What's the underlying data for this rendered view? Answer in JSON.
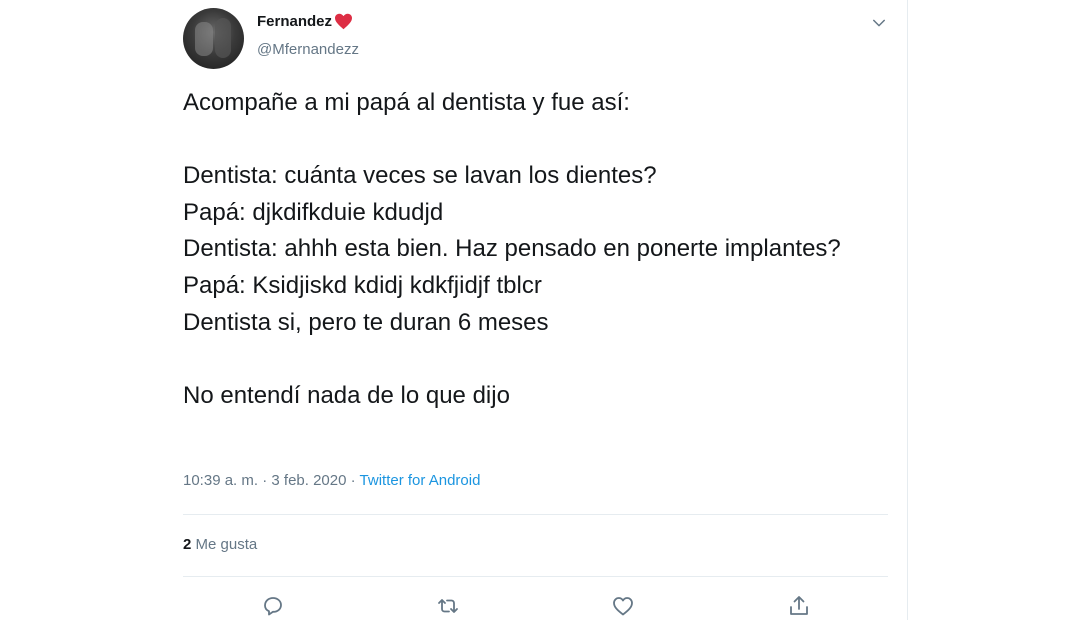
{
  "author": {
    "display_name": "Fernandez",
    "handle": "@Mfernandezz"
  },
  "tweet": {
    "text": "Acompañe a mi papá al dentista y fue así:\n\nDentista: cuánta veces se lavan los dientes?\nPapá: djkdifkduie kdudjd\nDentista: ahhh esta bien. Haz pensado en ponerte implantes?\nPapá: Ksidjiskd kdidj kdkfjidjf tblcr\nDentista si, pero te duran 6 meses\n\nNo entendí nada de lo que dijo",
    "time": "10:39 a. m.",
    "separator": " · ",
    "date": "3 feb. 2020",
    "source": "Twitter for Android"
  },
  "stats": {
    "likes_count": "2",
    "likes_label": "Me gusta"
  },
  "icons": {
    "name_emoji": "heart-icon",
    "menu": "chevron-down-icon",
    "reply": "reply-icon",
    "retweet": "retweet-icon",
    "like": "like-icon",
    "share": "share-icon"
  },
  "colors": {
    "text": "#14171a",
    "secondary": "#657786",
    "link": "#1b95e0",
    "heart": "#dd2e44",
    "divider": "#e6ecf0"
  }
}
